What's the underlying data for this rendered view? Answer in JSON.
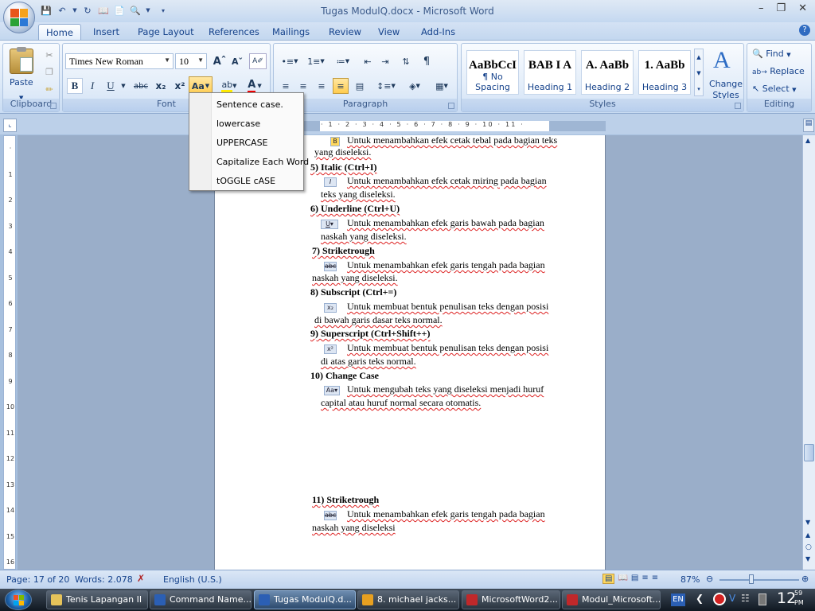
{
  "window": {
    "title": "Tugas ModulQ.docx - Microsoft Word"
  },
  "tabs": [
    "Home",
    "Insert",
    "Page Layout",
    "References",
    "Mailings",
    "Review",
    "View",
    "Add-Ins"
  ],
  "ribbon": {
    "clipboard": {
      "label": "Clipboard",
      "paste": "Paste"
    },
    "font": {
      "label": "Font",
      "name": "Times New Roman",
      "size": "10"
    },
    "paragraph": {
      "label": "Paragraph"
    },
    "styles": {
      "label": "Styles",
      "items": [
        {
          "preview": "AaBbCcI",
          "name": "¶ No Spacing"
        },
        {
          "preview": "BAB I  A",
          "name": "Heading 1"
        },
        {
          "preview": "A.  AaBb",
          "name": "Heading 2"
        },
        {
          "preview": "1.  AaBb",
          "name": "Heading 3"
        }
      ],
      "change_styles": "Change Styles"
    },
    "editing": {
      "label": "Editing",
      "find": "Find",
      "replace": "Replace",
      "select": "Select"
    }
  },
  "change_case_menu": [
    "Sentence case.",
    "lowercase",
    "UPPERCASE",
    "Capitalize Each Word",
    "tOGGLE cASE"
  ],
  "document": {
    "lines": {
      "l1": "Untuk menambahkan efek cetak tebal pada bagian teks",
      "l2": "yang diseleksi.",
      "h5": "5) Italic (Ctrl+I)",
      "l3": "Untuk menambahkan efek cetak miring pada bagian",
      "l4": "teks yang diseleksi.",
      "h6": "6)  Underline (Ctrl+U)",
      "l5": "Untuk menambahkan efek garis bawah pada bagian",
      "l6": "naskah yang diseleksi.",
      "h7": "7) Striketrough",
      "l7": "Untuk menambahkan efek garis tengah pada bagian",
      "l8": "naskah yang diseleksi.",
      "h8": "8) Subscript (Ctrl+=)",
      "l9": "Untuk membuat bentuk penulisan teks dengan posisi",
      "l10": "di bawah garis dasar teks normal.",
      "h9": "9)  Superscript (Ctrl+Shift++)",
      "l11": "Untuk membuat bentuk penulisan teks dengan posisi",
      "l12": "di atas garis teks normal.",
      "h10": "10)   Change Case",
      "l13": "Untuk mengubah teks yang diseleksi menjadi huruf",
      "l14": "capital atau huruf normal secara otomatis.",
      "h11": "11)  Striketrough",
      "l15": "Untuk menambahkan efek garis tengah pada bagian",
      "l16": "naskah yang diseleksi"
    }
  },
  "status": {
    "page": "Page: 17 of 20",
    "words": "Words: 2.078",
    "language": "English (U.S.)",
    "zoom": "87%"
  },
  "taskbar": {
    "items": [
      "Tenis Lapangan II",
      "Command Name...",
      "Tugas ModulQ.d...",
      "8. michael jacks...",
      "MicrosoftWord2...",
      "Modul_Microsoft..."
    ],
    "lang": "EN",
    "clock": "12",
    "clock_min": "59",
    "clock_ampm": "PM"
  }
}
